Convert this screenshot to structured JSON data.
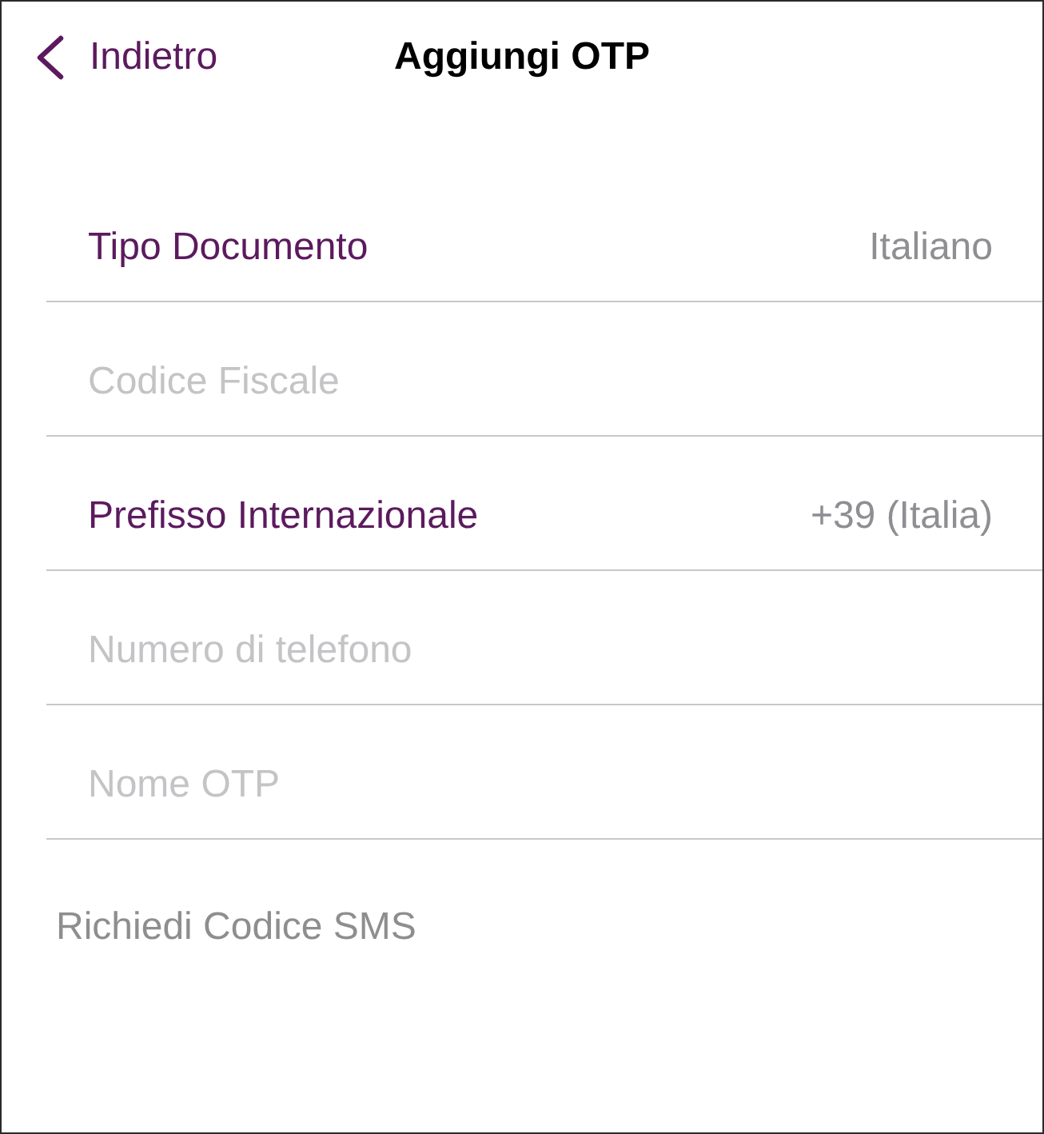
{
  "nav": {
    "back_label": "Indietro",
    "title": "Aggiungi OTP"
  },
  "form": {
    "rows": [
      {
        "kind": "picker",
        "label": "Tipo Documento",
        "value": "Italiano"
      },
      {
        "kind": "input",
        "placeholder": "Codice Fiscale"
      },
      {
        "kind": "picker",
        "label": "Prefisso Internazionale",
        "value": "+39 (Italia)"
      },
      {
        "kind": "input",
        "placeholder": "Numero di telefono"
      },
      {
        "kind": "input",
        "placeholder": "Nome OTP"
      }
    ]
  },
  "submit": {
    "label": "Richiedi Codice SMS",
    "disabled": true
  }
}
